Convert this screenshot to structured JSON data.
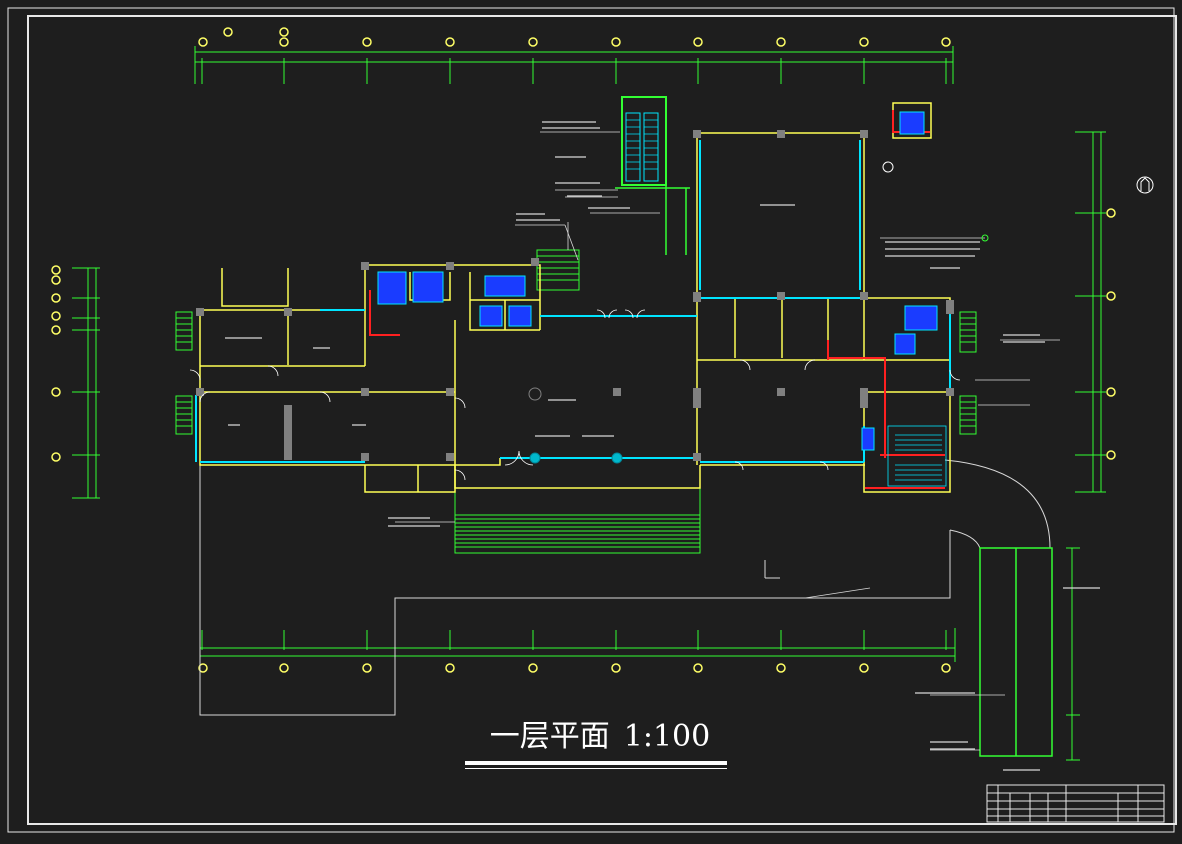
{
  "drawing": {
    "title": "一层平面",
    "scale": "1:100",
    "colors": {
      "background": "#1e1e1e",
      "frame": "#e8e8e8",
      "wall": "#ffff55",
      "glazing": "#00e5ff",
      "dimension": "#33ff33",
      "column": "#808080",
      "fire_line": "#ff2020",
      "stair_blue": "#1a3cff",
      "grid_bubble": "#ffff66",
      "text": "#ffffff"
    },
    "icons": [
      "north-arrow-icon",
      "grid-axis-bubble-icon",
      "column-icon",
      "stair-icon",
      "door-swing-icon"
    ]
  }
}
